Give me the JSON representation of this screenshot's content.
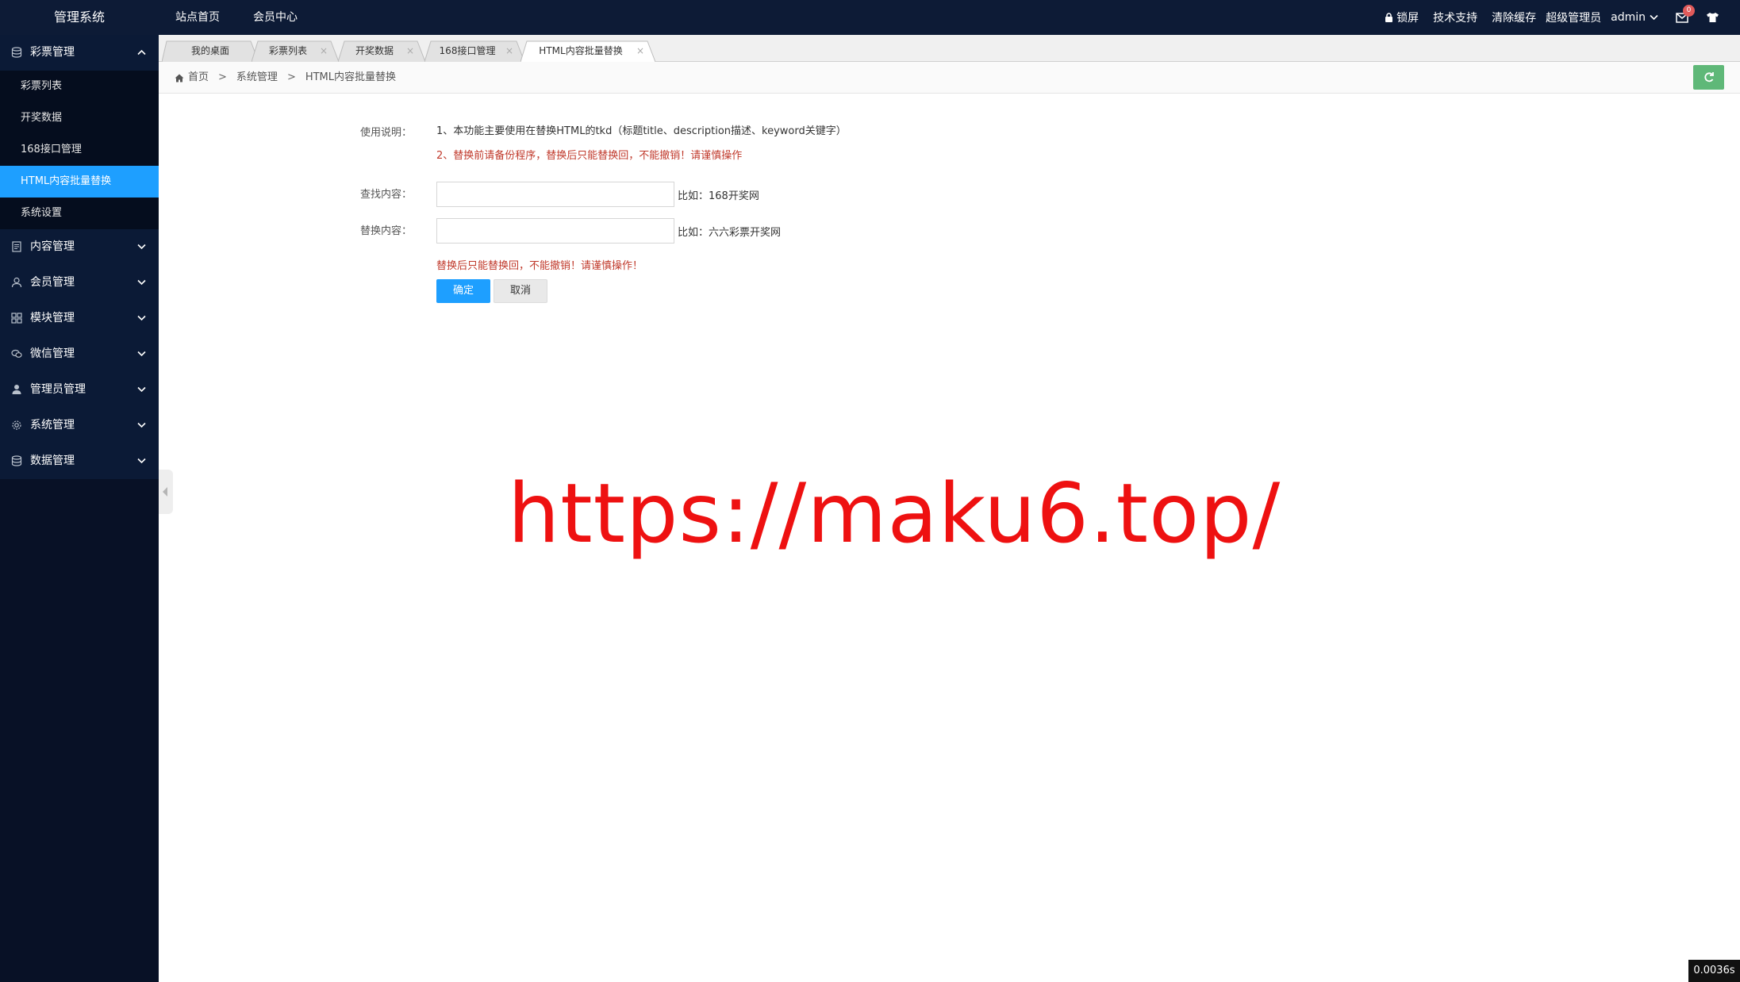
{
  "header": {
    "logo": "管理系统",
    "nav": [
      "站点首页",
      "会员中心"
    ],
    "lock": "锁屏",
    "support": "技术支持",
    "clear_cache": "清除缓存",
    "role": "超级管理员",
    "user": "admin",
    "mail_badge": "0"
  },
  "sidebar": {
    "groups": [
      {
        "label": "彩票管理",
        "icon": "database-icon",
        "expanded": true,
        "items": [
          "彩票列表",
          "开奖数据",
          "168接口管理",
          "HTML内容批量替换",
          "系统设置"
        ],
        "active_item": "HTML内容批量替换"
      },
      {
        "label": "内容管理",
        "icon": "document-icon"
      },
      {
        "label": "会员管理",
        "icon": "user-icon"
      },
      {
        "label": "模块管理",
        "icon": "grid-icon"
      },
      {
        "label": "微信管理",
        "icon": "wechat-icon"
      },
      {
        "label": "管理员管理",
        "icon": "admin-icon"
      },
      {
        "label": "系统管理",
        "icon": "gear-icon"
      },
      {
        "label": "数据管理",
        "icon": "database-icon"
      }
    ]
  },
  "tabs": [
    {
      "label": "我的桌面",
      "closable": false
    },
    {
      "label": "彩票列表",
      "closable": true
    },
    {
      "label": "开奖数据",
      "closable": true
    },
    {
      "label": "168接口管理",
      "closable": true
    },
    {
      "label": "HTML内容批量替换",
      "closable": true,
      "active": true
    }
  ],
  "tab_close_glyph": "×",
  "breadcrumb": {
    "home": "首页",
    "sep": ">",
    "items": [
      "系统管理",
      "HTML内容批量替换"
    ]
  },
  "form": {
    "usage_label": "使用说明：",
    "usage_line1": "1、本功能主要使用在替换HTML的tkd（标题title、description描述、keyword关键字）",
    "usage_line2": "2、替换前请备份程序，替换后只能替换回，不能撤销！请谨慎操作",
    "find_label": "查找内容：",
    "find_value": "",
    "find_hint": "比如：168开奖网",
    "replace_label": "替换内容：",
    "replace_value": "",
    "replace_hint": "比如：六六彩票开奖网",
    "warning": "替换后只能替换回，不能撤销！请谨慎操作！",
    "ok_label": "确定",
    "cancel_label": "取消"
  },
  "watermark": "https://maku6.top/",
  "timer": "0.0036s",
  "colors": {
    "header_bg": "#0d1b36",
    "sidebar_bg": "#081126",
    "active": "#1e9fff",
    "refresh": "#5fb878",
    "warning": "#c0392b",
    "watermark": "#ee1111"
  }
}
